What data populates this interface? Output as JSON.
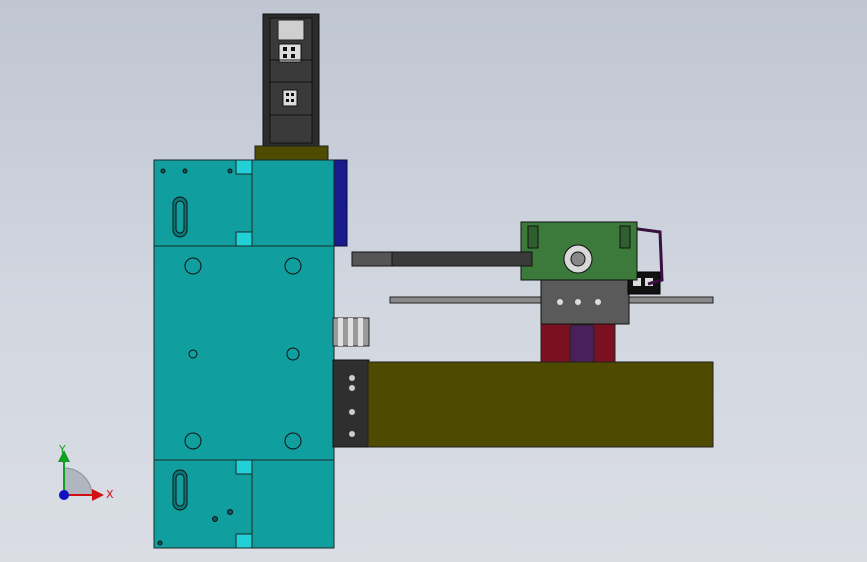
{
  "viewport": {
    "background_top": "#bfc6d2",
    "background_bottom": "#dadde4"
  },
  "colors": {
    "plate_teal": "#119e9e",
    "plate_teal_dark": "#0a7676",
    "plate_edge": "#1b2a2a",
    "cyan_accent": "#22d0d8",
    "olive_body": "#4e4a00",
    "olive_dark": "#3a3700",
    "motor_gray": "#2f2f2f",
    "green_block": "#3b7a3b",
    "navy_part": "#1a1a8a",
    "maroon_part": "#7a1020",
    "purple_part": "#4a1f5a",
    "axis_x": "#d01010",
    "axis_y": "#10a020",
    "axis_z": "#1010c0"
  },
  "triad": {
    "x_label": "X",
    "y_label": "Y"
  }
}
